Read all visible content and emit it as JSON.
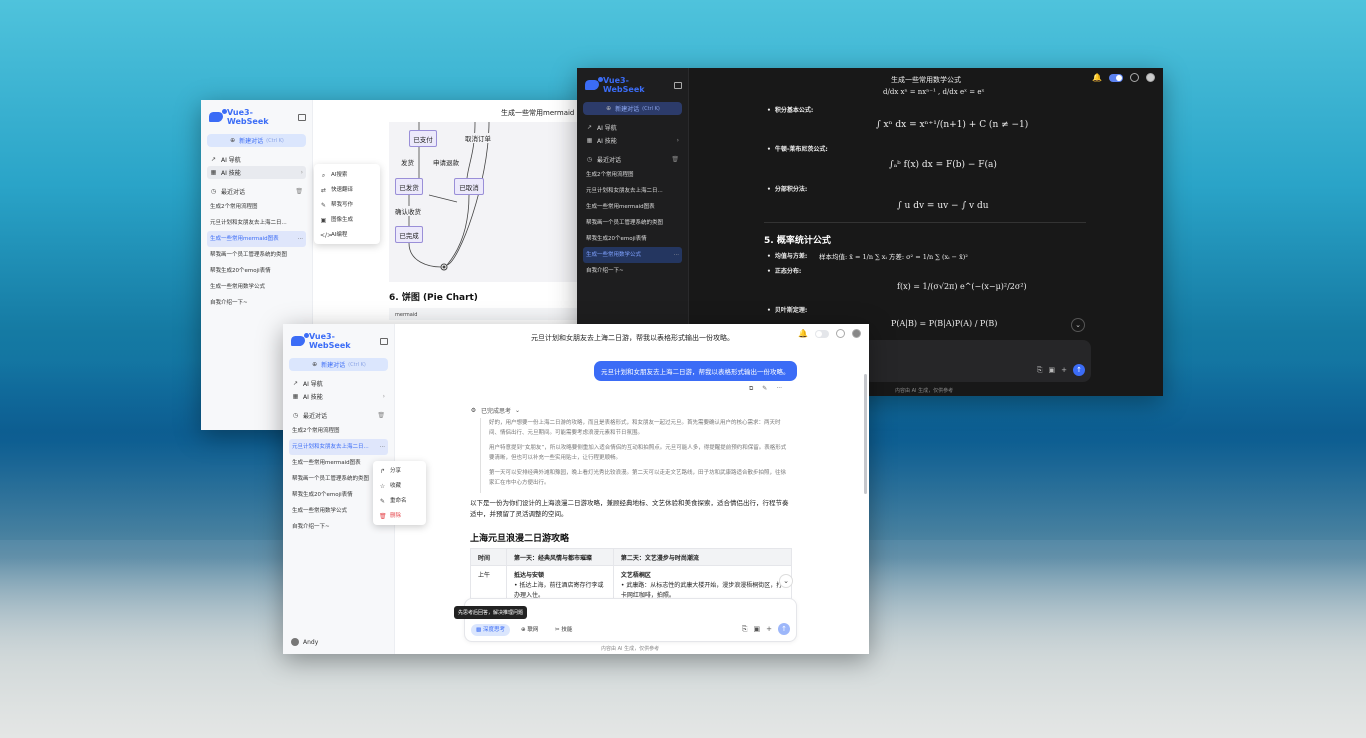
{
  "app": {
    "name": "Vue3-WebSeek",
    "new_chat": "新建对话",
    "new_chat_kbd": "(Ctrl K)",
    "nav_ai": "AI 导航",
    "nav_skills": "AI 技能",
    "recent": "最近对话",
    "user": "Andy",
    "footer": "内容由 AI 生成，仅供参考"
  },
  "history": [
    "生成2个常用流程图",
    "元旦计划和女朋友去上海二日...",
    "生成一些常用mermaid图表",
    "帮我画一个员工管理系统的类图",
    "帮我生成20个emoji表情",
    "生成一些常用数学公式",
    "自我介绍一下~"
  ],
  "window1": {
    "title": "生成一些常用mermaid",
    "submenu": [
      "AI搜索",
      "快速翻译",
      "帮我写作",
      "图像生成",
      "AI编程"
    ],
    "nodes": {
      "paid": "已支付",
      "shipped": "已发货",
      "cancelled": "已取消",
      "done": "已完成"
    },
    "edges": {
      "cancel_order": "取消订单",
      "ship": "发货",
      "refund": "申请退款",
      "confirm": "确认收货"
    },
    "pie_heading": "6. 饼图 (Pie Chart)",
    "code_lang": "mermaid"
  },
  "window2": {
    "title": "生成一些常用数学公式",
    "integral_basic": "积分基本公式:",
    "newton": "牛顿-莱布尼茨公式:",
    "parts": "分部积分法:",
    "section5": "5. 概率统计公式",
    "mean_var": "均值与方差:",
    "mean_var_text": "样本均值: x̄ = 1/n ∑ xᵢ  方差: σ² = 1/n ∑ (xᵢ − x̄)²",
    "normal": "正态分布:",
    "bayes": "贝叶斯定理:",
    "f_deriv": "d/dx xⁿ = nxⁿ⁻¹ ,   d/dx eˣ = eˣ",
    "f_int": "∫ xⁿ dx = xⁿ⁺¹/(n+1) + C   (n ≠ −1)",
    "f_newton": "∫ₐᵇ f(x) dx = F(b) − F(a)",
    "f_parts": "∫ u dv = uv − ∫ v du",
    "f_normal": "f(x) = 1/(σ√2π) e^(−(x−μ)²/2σ²)",
    "f_bayes": "P(A|B) = P(B|A)P(A) / P(B)"
  },
  "window3": {
    "title": "元旦计划和女朋友去上海二日游，帮我以表格形式输出一份攻略。",
    "user_message": "元旦计划和女朋友去上海二日游，帮我以表格形式输出一份攻略。",
    "menu": [
      "分享",
      "收藏",
      "重命名",
      "删除"
    ],
    "thinking_status": "已完成思考",
    "thinking": [
      "好的，用户想要一份上海二日游的攻略，而且是表格形式，和女朋友一起过元旦。首先需要确认用户的核心需求：两天时间、情侣出行、元旦期间。可能需要考虑浪漫元素和节日氛围。",
      "用户特意提到“女朋友”，所以攻略要侧重加入适合情侣的互动和拍照点。元旦可能人多，得提醒提前预约和保留。表格形式要清晰，但也可以补充一些实用贴士，让行程更顺畅。",
      "第一天可以安排经典外滩和豫园，晚上看灯光秀比较浪漫。第二天可以走走文艺路线，田子坊和武康路适合散步拍照，往徐家汇在市中心方便出行。"
    ],
    "answer": "以下是一份为你们设计的上海浪漫二日游攻略，兼顾经典地标、文艺休验和美食探索，适合情侣出行，行程节奏适中，并预留了灵活调整的空间。",
    "heading": "上海元旦浪漫二日游攻略",
    "table_headers": [
      "时间",
      "第一天：经典风情与都市璀璨",
      "第二天：文艺漫步与时尚潮流"
    ],
    "row_time": "上午",
    "row_day1_title": "抵达与安顿",
    "row_day1_text": "• 抵达上海，前往酒店寄存行李或办理入住。",
    "row_day2_title": "文艺梧桐区",
    "row_day2_text": "• 武康路：从标志性的武康大楼开始，漫步浪漫梧桐街区，打卡网红咖啡，拍照。",
    "tooltip": "先思考后回答，解决推理问题",
    "chip_deep": "深度思考",
    "chip_web": "联网",
    "chip_skill": "技能"
  }
}
